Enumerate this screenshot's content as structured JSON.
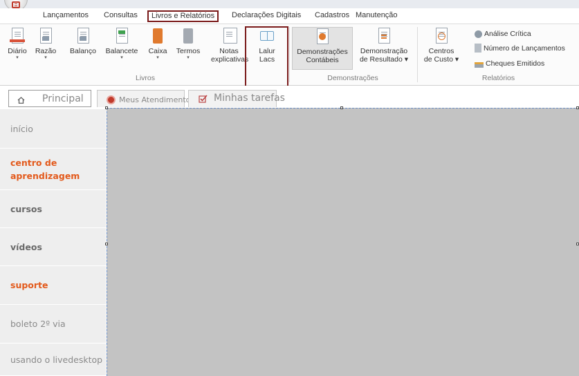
{
  "menu": {
    "tabs": [
      "Lançamentos",
      "Consultas",
      "Livros e Relatórios",
      "Declarações Digitais",
      "Cadastros",
      "Manutenção"
    ],
    "active_tab": "Livros e Relatórios"
  },
  "ribbon": {
    "livros": {
      "diario": "Diário",
      "razao": "Razão",
      "balanco": "Balanço",
      "balancete": "Balancete",
      "caixa": "Caixa",
      "termos": "Termos",
      "notas_line1": "Notas",
      "notas_line2": "explicativas",
      "lalur_line1": "Lalur",
      "lalur_line2": "Lacs",
      "group_label": "Livros"
    },
    "demonstracoes": {
      "contabeis_line1": "Demonstrações",
      "contabeis_line2": "Contábeis",
      "resultado_line1": "Demonstração",
      "resultado_line2": "de Resultado ▾",
      "group_label": "Demonstrações"
    },
    "relatorios": {
      "centros_line1": "Centros",
      "centros_line2": "de Custo ▾",
      "analise": "Análise Crítica",
      "numero": "Número de Lançamentos",
      "cheques": "Cheques Emitidos",
      "group_label": "Relatórios"
    },
    "dropdown_arrow": "▾"
  },
  "tabs": {
    "principal": "Principal",
    "atendimentos": "Meus Atendimentos",
    "tarefas": "Minhas tarefas"
  },
  "sidebar": {
    "items": [
      {
        "label": "início"
      },
      {
        "label": "centro de aprendizagem"
      },
      {
        "label": "cursos"
      },
      {
        "label": "vídeos"
      },
      {
        "label": "suporte"
      },
      {
        "label": "boleto 2º via"
      },
      {
        "label": "usando o livedesktop"
      }
    ]
  },
  "colors": {
    "highlight_border": "#7a1a1a",
    "accent_orange": "#e35a1c",
    "content_bg": "#c3c3c3"
  }
}
